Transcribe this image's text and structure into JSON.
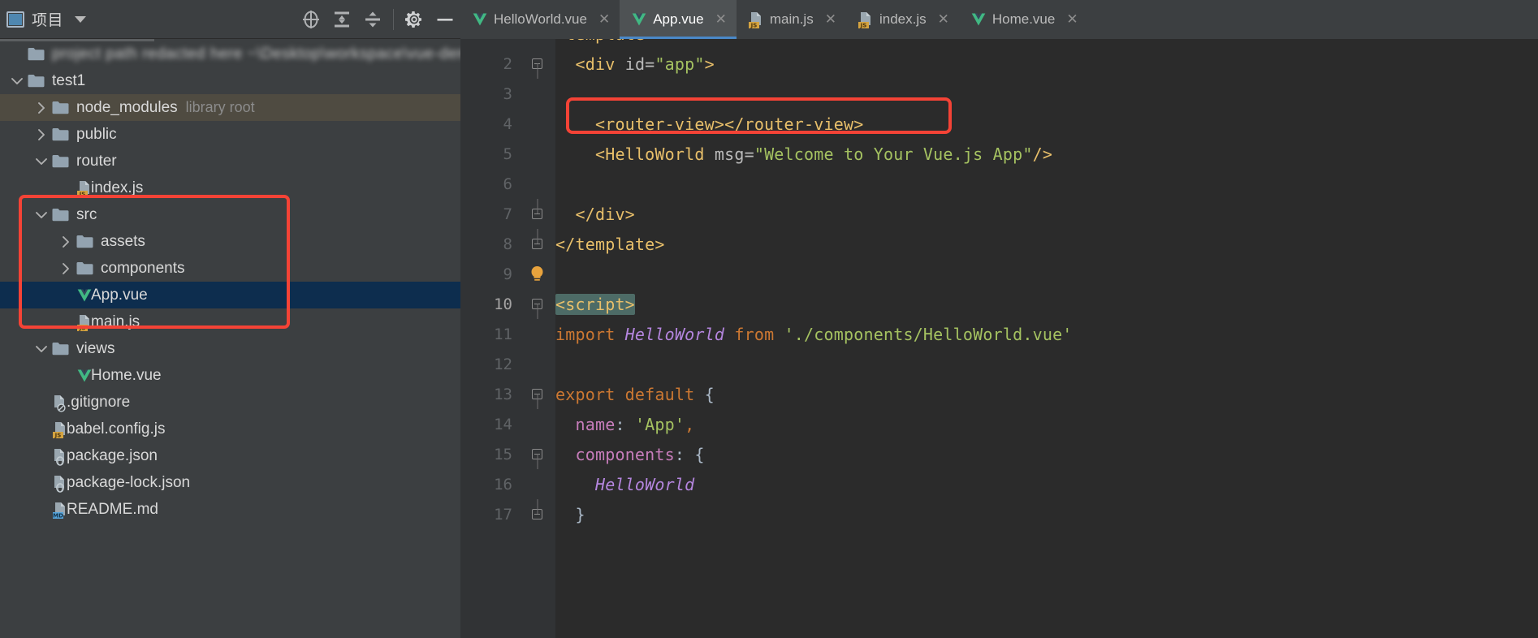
{
  "window": {
    "project_panel_title": "项目",
    "colors": {
      "accent_tab_underline": "#4a88c7",
      "annotation_red": "#f44336",
      "selection_blue": "#0d2d4e",
      "library_root_row": "#4f4b41",
      "editor_bg": "#2b2b2b",
      "panel_bg": "#3c3f41"
    }
  },
  "project_toolbar": {
    "buttons": [
      {
        "name": "locate-icon",
        "title": "Select Opened File"
      },
      {
        "name": "expand-all-icon",
        "title": "Expand All"
      },
      {
        "name": "collapse-all-icon",
        "title": "Collapse All"
      },
      {
        "name": "gear-icon",
        "title": "Settings"
      },
      {
        "name": "minimize-icon",
        "title": "Hide"
      }
    ]
  },
  "tabs": [
    {
      "label": "HelloWorld.vue",
      "icon": "vue-icon",
      "active": false,
      "close": "✕"
    },
    {
      "label": "App.vue",
      "icon": "vue-icon",
      "active": true,
      "close": "✕"
    },
    {
      "label": "main.js",
      "icon": "js-icon",
      "active": false,
      "close": "✕"
    },
    {
      "label": "index.js",
      "icon": "js-icon",
      "active": false,
      "close": "✕"
    },
    {
      "label": "Home.vue",
      "icon": "vue-icon",
      "active": false,
      "close": "✕"
    }
  ],
  "tree": [
    {
      "label": "",
      "blurred": true,
      "indent": 0,
      "arrow": "none",
      "icon": "folder-icon",
      "state": "normal",
      "suffix": ""
    },
    {
      "label": "test1",
      "indent": 0,
      "arrow": "down",
      "icon": "folder-icon",
      "state": "normal",
      "suffix": ""
    },
    {
      "label": "node_modules",
      "indent": 1,
      "arrow": "right",
      "icon": "folder-icon",
      "state": "library-root",
      "suffix": "library root"
    },
    {
      "label": "public",
      "indent": 1,
      "arrow": "right",
      "icon": "folder-icon",
      "state": "normal",
      "suffix": ""
    },
    {
      "label": "router",
      "indent": 1,
      "arrow": "down",
      "icon": "folder-icon",
      "state": "normal",
      "suffix": ""
    },
    {
      "label": "index.js",
      "indent": 2,
      "arrow": "none",
      "icon": "js-icon",
      "state": "normal",
      "suffix": ""
    },
    {
      "label": "src",
      "indent": 1,
      "arrow": "down",
      "icon": "folder-icon",
      "state": "normal",
      "suffix": ""
    },
    {
      "label": "assets",
      "indent": 2,
      "arrow": "right",
      "icon": "folder-icon",
      "state": "normal",
      "suffix": ""
    },
    {
      "label": "components",
      "indent": 2,
      "arrow": "right",
      "icon": "folder-icon",
      "state": "normal",
      "suffix": ""
    },
    {
      "label": "App.vue",
      "indent": 2,
      "arrow": "none",
      "icon": "vue-icon",
      "state": "selected",
      "suffix": ""
    },
    {
      "label": "main.js",
      "indent": 2,
      "arrow": "none",
      "icon": "js-icon",
      "state": "normal",
      "suffix": ""
    },
    {
      "label": "views",
      "indent": 1,
      "arrow": "down",
      "icon": "folder-icon",
      "state": "normal",
      "suffix": ""
    },
    {
      "label": "Home.vue",
      "indent": 2,
      "arrow": "none",
      "icon": "vue-icon",
      "state": "normal",
      "suffix": ""
    },
    {
      "label": ".gitignore",
      "indent": 1,
      "arrow": "none",
      "icon": "gitignore-icon",
      "state": "normal",
      "suffix": ""
    },
    {
      "label": "babel.config.js",
      "indent": 1,
      "arrow": "none",
      "icon": "js-icon",
      "state": "normal",
      "suffix": ""
    },
    {
      "label": "package.json",
      "indent": 1,
      "arrow": "none",
      "icon": "json-icon",
      "state": "normal",
      "suffix": ""
    },
    {
      "label": "package-lock.json",
      "indent": 1,
      "arrow": "none",
      "icon": "json-icon",
      "state": "normal",
      "suffix": ""
    },
    {
      "label": "README.md",
      "indent": 1,
      "arrow": "none",
      "icon": "md-icon",
      "state": "normal",
      "suffix": ""
    }
  ],
  "editor": {
    "file": "App.vue",
    "current_line": 10,
    "lines": [
      {
        "n": 1,
        "fold": "none",
        "indent": 0,
        "tokens": [
          {
            "t": "<template>",
            "c": "t-tag"
          }
        ],
        "clipped_top": true
      },
      {
        "n": 2,
        "fold": "minus-top",
        "indent": 0,
        "tokens": [
          {
            "t": "  ",
            "c": "t-punc"
          },
          {
            "t": "<div ",
            "c": "t-tag"
          },
          {
            "t": "id=",
            "c": "t-attr"
          },
          {
            "t": "\"app\"",
            "c": "t-str"
          },
          {
            "t": ">",
            "c": "t-tag"
          }
        ]
      },
      {
        "n": 3,
        "fold": "none",
        "indent": 0,
        "tokens": []
      },
      {
        "n": 4,
        "fold": "none",
        "indent": 0,
        "tokens": [
          {
            "t": "    <router-view></router-view>",
            "c": "t-tag"
          }
        ]
      },
      {
        "n": 5,
        "fold": "none",
        "indent": 0,
        "tokens": [
          {
            "t": "    <HelloWorld ",
            "c": "t-tag"
          },
          {
            "t": "msg=",
            "c": "t-attr"
          },
          {
            "t": "\"Welcome to Your Vue.js App\"",
            "c": "t-str"
          },
          {
            "t": "/>",
            "c": "t-tag"
          }
        ]
      },
      {
        "n": 6,
        "fold": "none",
        "indent": 0,
        "tokens": []
      },
      {
        "n": 7,
        "fold": "minus-bottom",
        "indent": 0,
        "tokens": [
          {
            "t": "  </div>",
            "c": "t-tag"
          }
        ]
      },
      {
        "n": 8,
        "fold": "minus-bottom",
        "indent": 0,
        "tokens": [
          {
            "t": "</template>",
            "c": "t-tag"
          }
        ]
      },
      {
        "n": 9,
        "fold": "bulb",
        "indent": 0,
        "tokens": []
      },
      {
        "n": 10,
        "fold": "minus-top",
        "indent": 0,
        "tokens": [
          {
            "t": "<script>",
            "c": "t-script sel-hl"
          }
        ]
      },
      {
        "n": 11,
        "fold": "none",
        "indent": 0,
        "tokens": [
          {
            "t": "import ",
            "c": "t-kw"
          },
          {
            "t": "HelloWorld",
            "c": "t-cls"
          },
          {
            "t": " from ",
            "c": "t-kw"
          },
          {
            "t": "'./components/HelloWorld.vue'",
            "c": "t-str"
          }
        ]
      },
      {
        "n": 12,
        "fold": "none",
        "indent": 0,
        "tokens": []
      },
      {
        "n": 13,
        "fold": "minus-top",
        "indent": 0,
        "tokens": [
          {
            "t": "export default",
            "c": "t-kw"
          },
          {
            "t": " {",
            "c": "t-punc"
          }
        ]
      },
      {
        "n": 14,
        "fold": "none",
        "indent": 0,
        "tokens": [
          {
            "t": "  ",
            "c": "t-punc"
          },
          {
            "t": "name",
            "c": "t-prop"
          },
          {
            "t": ": ",
            "c": "t-punc"
          },
          {
            "t": "'App'",
            "c": "t-str"
          },
          {
            "t": ",",
            "c": "t-kw"
          }
        ]
      },
      {
        "n": 15,
        "fold": "minus-top",
        "indent": 0,
        "tokens": [
          {
            "t": "  ",
            "c": "t-punc"
          },
          {
            "t": "components",
            "c": "t-prop"
          },
          {
            "t": ": {",
            "c": "t-punc"
          }
        ]
      },
      {
        "n": 16,
        "fold": "none",
        "indent": 1,
        "tokens": [
          {
            "t": "    ",
            "c": "t-punc"
          },
          {
            "t": "HelloWorld",
            "c": "t-cls"
          }
        ]
      },
      {
        "n": 17,
        "fold": "minus-bottom",
        "indent": 0,
        "tokens": [
          {
            "t": "  }",
            "c": "t-punc"
          }
        ]
      }
    ]
  },
  "annotations": [
    {
      "name": "tree-src-highlight",
      "target": "src folder through main.js"
    },
    {
      "name": "code-router-view-highlight",
      "target": "line 4 router-view tag"
    }
  ]
}
